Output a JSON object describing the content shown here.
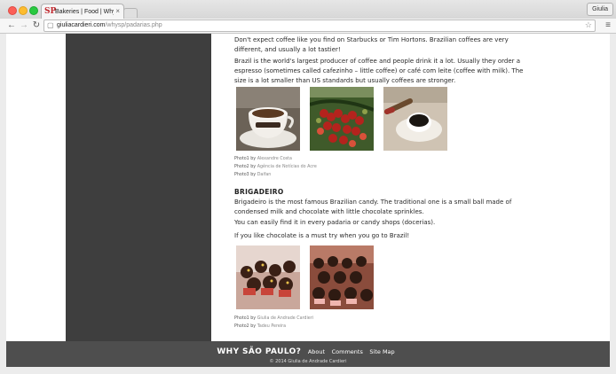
{
  "browser": {
    "tab_title": "Bakeries | Food | Why São",
    "favicon_text": "SP",
    "profile_name": "Giulia",
    "url_host": "giuliacardieri.com",
    "url_path": "/whysp/padarias.php"
  },
  "article": {
    "coffee_p1": "Don't expect coffee like you find on Starbucks or Tim Hortons. Brazilian coffees are very different, and usually a lot tastier!",
    "coffee_p2": "Brazil is the world's largest producer of coffee and people drink it a lot. Usually they order a espresso (sometimes called cafezinho – little coffee) or café com leite (coffee with milk). The size is a lot smaller than US standards but usually coffees are stronger.",
    "coffee_credits": [
      {
        "label": "Photo1 by",
        "author": "Alexandre Costa"
      },
      {
        "label": "Photo2 by",
        "author": "Agência de Notícias do Acre"
      },
      {
        "label": "Photo3 by",
        "author": "Daifan"
      }
    ],
    "brigadeiro_heading": "BRIGADEIRO",
    "brigadeiro_p1": "Brigadeiro is the most famous Brazilian candy. The traditional one is a small ball made of condensed milk and chocolate with little chocolate sprinkles.",
    "brigadeiro_p2": "You can easily find it in every padaria or candy shops (docerias).",
    "brigadeiro_p3": "If you like chocolate is a must try when you go to Brazil!",
    "brigadeiro_credits": [
      {
        "label": "Photo1 by",
        "author": "Giulia de Andrade Cardieri"
      },
      {
        "label": "Photo2 by",
        "author": "Tadeu Pereira"
      }
    ]
  },
  "footer": {
    "brand": "WHY SÃO PAULO?",
    "links": [
      "About",
      "Comments",
      "Site Map"
    ],
    "copyright": "© 2014 Giulia de Andrade Cardieri"
  },
  "colors": {
    "sidebar": "#3e3e3e",
    "footer": "#4e4e4e",
    "favicon": "#c0272d"
  }
}
